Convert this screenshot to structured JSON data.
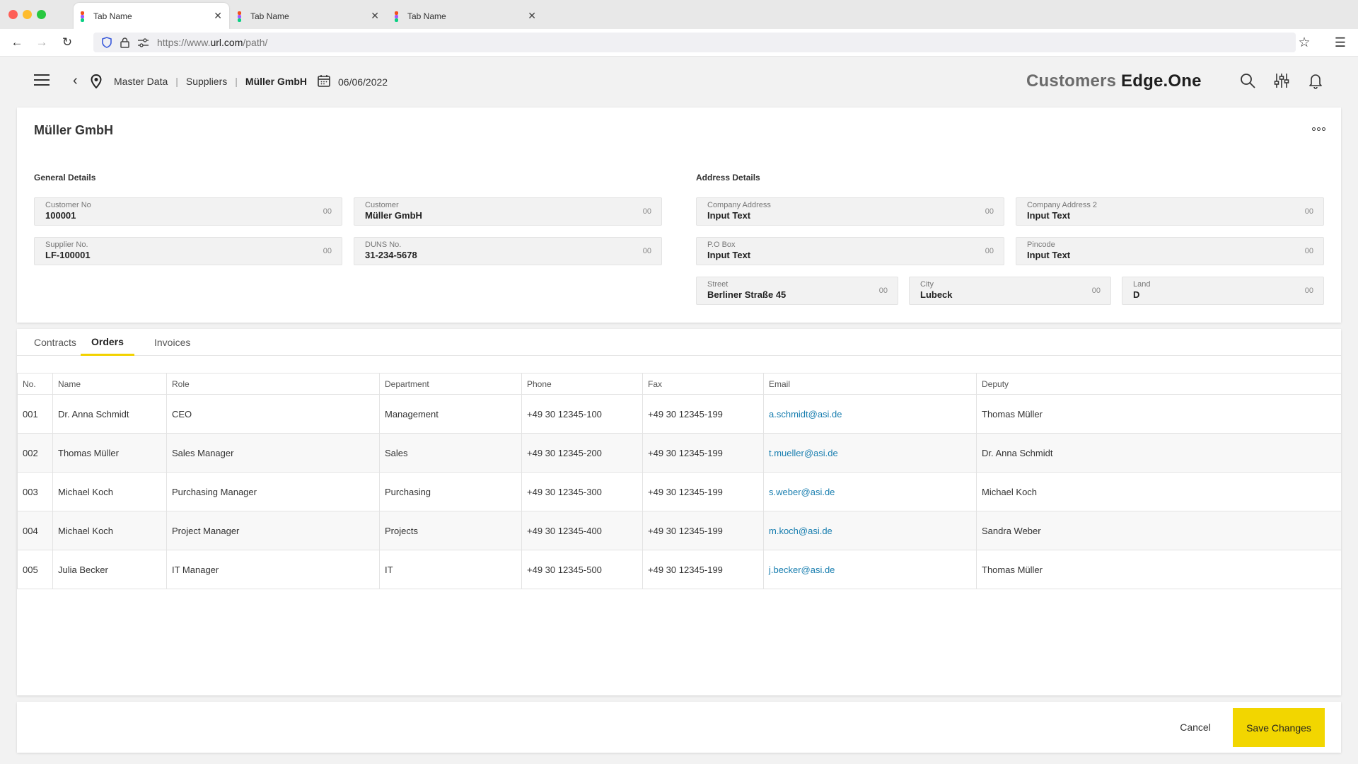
{
  "browser": {
    "tabs": [
      {
        "label": "Tab Name"
      },
      {
        "label": "Tab Name"
      },
      {
        "label": "Tab Name"
      }
    ],
    "url_prefix": "https://www.",
    "url_domain": "url.com",
    "url_path": "/path/"
  },
  "header": {
    "breadcrumb": [
      "Master Data",
      "Suppliers",
      "Müller GmbH"
    ],
    "date": "06/06/2022",
    "brand_part1": "Customers",
    "brand_part2": "Edge.One"
  },
  "details": {
    "title": "Müller GmbH",
    "general_label": "General Details",
    "address_label": "Address Details",
    "general_fields": [
      {
        "label": "Customer No",
        "value": "100001",
        "count": "00"
      },
      {
        "label": "Customer",
        "value": "Müller GmbH",
        "count": "00"
      },
      {
        "label": "Supplier No.",
        "value": "LF-100001",
        "count": "00"
      },
      {
        "label": "DUNS No.",
        "value": "31-234-5678",
        "count": "00"
      }
    ],
    "address_fields": [
      {
        "label": "Company Address",
        "value": "Input Text",
        "count": "00"
      },
      {
        "label": "Company Address 2",
        "value": "Input Text",
        "count": "00"
      },
      {
        "label": "P.O Box",
        "value": "Input Text",
        "count": "00"
      },
      {
        "label": "Pincode",
        "value": "Input Text",
        "count": "00"
      },
      {
        "label": "Street",
        "value": "Berliner Straße 45",
        "count": "00"
      },
      {
        "label": "City",
        "value": "Lubeck",
        "count": "00"
      },
      {
        "label": "Land",
        "value": "D",
        "count": "00"
      }
    ]
  },
  "tabs": [
    {
      "label": "Contracts"
    },
    {
      "label": "Orders",
      "active": true
    },
    {
      "label": "Invoices"
    }
  ],
  "table": {
    "headers": [
      "No.",
      "Name",
      "Role",
      "Department",
      "Phone",
      "Fax",
      "Email",
      "Deputy"
    ],
    "rows": [
      [
        "001",
        "Dr. Anna Schmidt",
        "CEO",
        "Management",
        "+49 30 12345-100",
        "+49 30 12345-199",
        "a.schmidt@asi.de",
        "Thomas Müller"
      ],
      [
        "002",
        "Thomas Müller",
        "Sales Manager",
        "Sales",
        "+49 30 12345-200",
        "+49 30 12345-199",
        "t.mueller@asi.de",
        "Dr. Anna Schmidt"
      ],
      [
        "003",
        "Michael Koch",
        "Purchasing Manager",
        "Purchasing",
        "+49 30 12345-300",
        "+49 30 12345-199",
        "s.weber@asi.de",
        "Michael Koch"
      ],
      [
        "004",
        "Michael Koch",
        "Project Manager",
        "Projects",
        "+49 30 12345-400",
        "+49 30 12345-199",
        "m.koch@asi.de",
        "Sandra Weber"
      ],
      [
        "005",
        "Julia Becker",
        "IT Manager",
        "IT",
        "+49 30 12345-500",
        "+49 30 12345-199",
        "j.becker@asi.de",
        "Thomas Müller"
      ]
    ]
  },
  "footer": {
    "cancel_label": "Cancel",
    "save_label": "Save Changes"
  },
  "colors": {
    "accent": "#f2d600",
    "link": "#1a7fb0"
  }
}
